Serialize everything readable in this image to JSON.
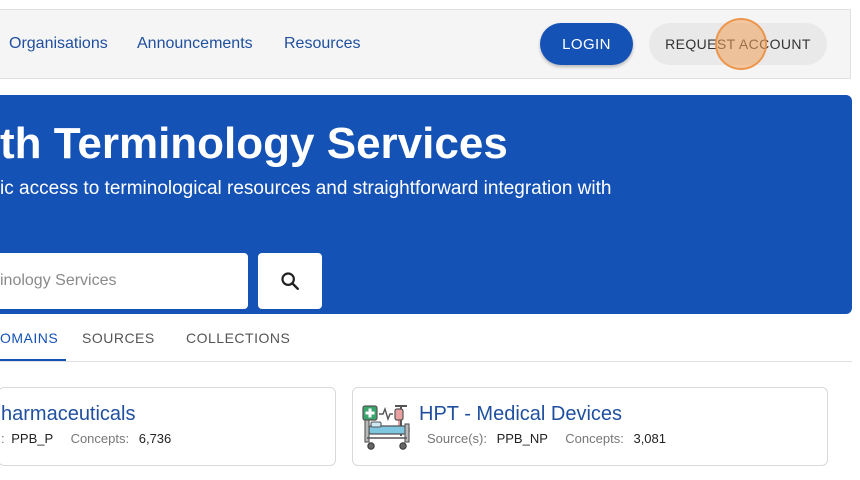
{
  "nav": {
    "links": [
      "Organisations",
      "Announcements",
      "Resources"
    ],
    "login_label": "LOGIN",
    "request_label": "REQUEST ACCOUNT"
  },
  "hero": {
    "title": "th Terminology Services",
    "subtitle": "ic access to terminological resources and straightforward integration with",
    "search_placeholder": "inology Services",
    "search_icon": "search-icon",
    "bg_color": "#1552b5"
  },
  "tabs": {
    "items": [
      "OMAINS",
      "SOURCES",
      "COLLECTIONS"
    ],
    "active_index": 0
  },
  "cards": [
    {
      "title": "harmaceuticals",
      "source_label": ":",
      "source_value": "PPB_P",
      "concepts_label": "Concepts:",
      "concepts_value": "6,736"
    },
    {
      "title": "HPT - Medical Devices",
      "icon": "hospital-bed-icon",
      "source_label": "Source(s):",
      "source_value": "PPB_NP",
      "concepts_label": "Concepts:",
      "concepts_value": "3,081"
    }
  ]
}
